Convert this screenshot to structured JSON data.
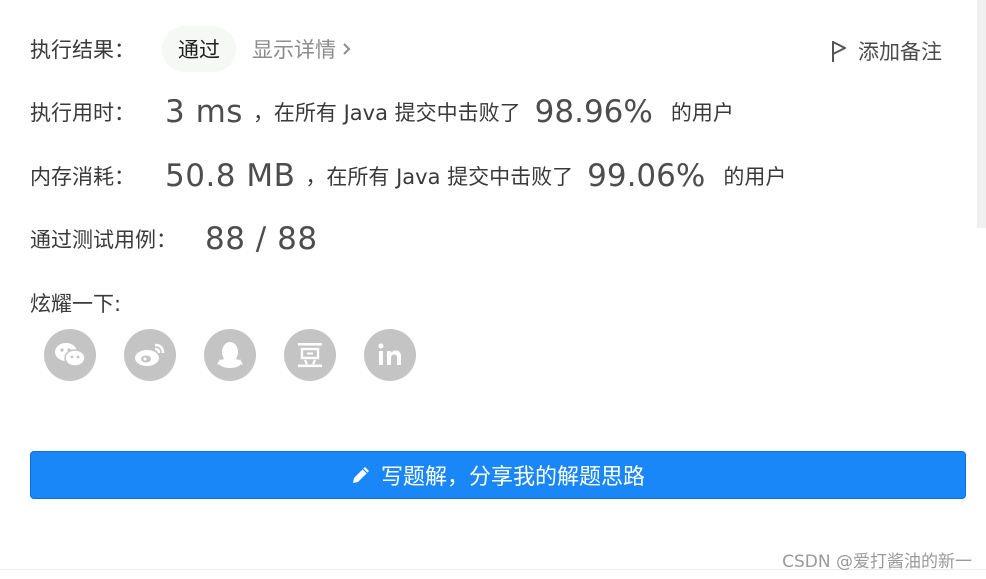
{
  "result": {
    "label": "执行结果：",
    "status": "通过",
    "details_link": "显示详情",
    "add_note": "添加备注"
  },
  "runtime": {
    "label": "执行用时：",
    "value": "3 ms",
    "beat_prefix": "，在所有 Java 提交中击败了",
    "percent": "98.96%",
    "beat_suffix": "的用户"
  },
  "memory": {
    "label": "内存消耗：",
    "value": "50.8 MB",
    "beat_prefix": "，在所有 Java 提交中击败了",
    "percent": "99.06%",
    "beat_suffix": "的用户"
  },
  "testcases": {
    "label": "通过测试用例：",
    "value": "88 / 88"
  },
  "share": {
    "label": "炫耀一下:",
    "icons": [
      "wechat-icon",
      "weibo-icon",
      "qq-icon",
      "douban-icon",
      "linkedin-icon"
    ]
  },
  "write_solution": {
    "label": "写题解，分享我的解题思路"
  },
  "watermark": "CSDN @爱打酱油的新一",
  "colors": {
    "primary_button": "#1a87f9",
    "share_icon_bg": "#c4c4c4",
    "badge_bg": "#f6f8f5"
  }
}
